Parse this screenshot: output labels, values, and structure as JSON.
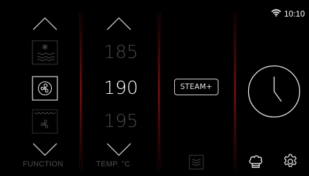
{
  "status_bar": {
    "time": "10:10",
    "wifi_icon": "wifi-icon"
  },
  "function_column": {
    "label": "FUNCTION",
    "modes": [
      {
        "name": "defrost",
        "icon": "defrost-icon",
        "state": "dim"
      },
      {
        "name": "fan",
        "icon": "fan-icon",
        "state": "selected"
      },
      {
        "name": "fan-bottom-heat",
        "icon": "fan-bottom-heat-icon",
        "state": "dim"
      }
    ]
  },
  "temperature_column": {
    "label": "TEMP. °C",
    "values": {
      "previous": "185",
      "current": "190",
      "next": "195"
    }
  },
  "steam": {
    "button_label": "STEAM+"
  },
  "bottom_icons": [
    "steam-tray-icon",
    "chef-hat-icon",
    "settings-icon"
  ],
  "timer": {
    "icon": "clock-icon"
  },
  "colors": {
    "background": "#000000",
    "separator": "#a81c1c",
    "dim_text": "#4a4a4a",
    "foreground": "#ffffff"
  }
}
